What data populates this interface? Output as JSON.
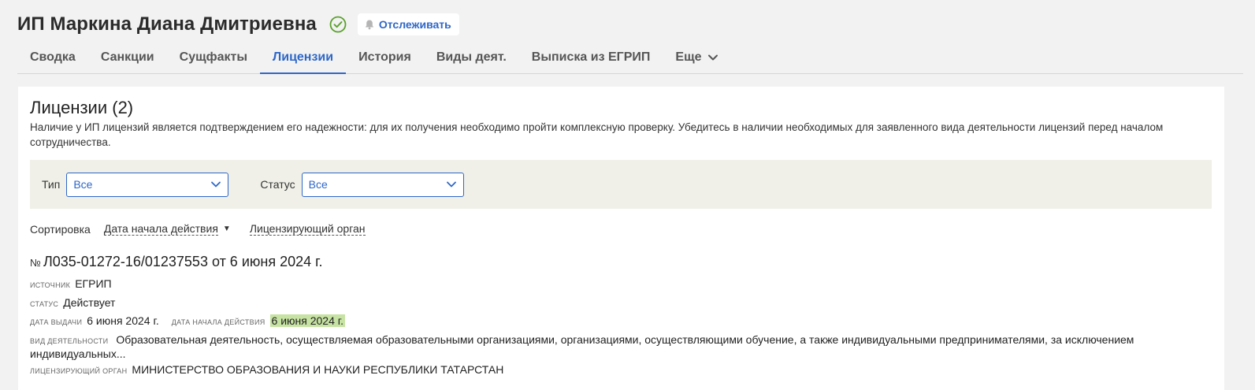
{
  "header": {
    "company_name": "ИП Маркина Диана Дмитриевна",
    "track_label": "Отслеживать"
  },
  "tabs": [
    {
      "label": "Сводка"
    },
    {
      "label": "Санкции"
    },
    {
      "label": "Сущфакты"
    },
    {
      "label": "Лицензии",
      "active": true
    },
    {
      "label": "История"
    },
    {
      "label": "Виды деят."
    },
    {
      "label": "Выписка из ЕГРИП"
    },
    {
      "label": "Еще"
    }
  ],
  "section": {
    "title": "Лицензии (2)",
    "description": "Наличие у ИП лицензий является подтверждением его надежности: для их получения необходимо пройти комплексную проверку. Убедитесь в наличии необходимых для заявленного вида деятельности лицензий перед началом сотрудничества."
  },
  "filters": {
    "type_label": "Тип",
    "type_value": "Все",
    "status_label": "Статус",
    "status_value": "Все"
  },
  "sort": {
    "label": "Сортировка",
    "option1": "Дата начала действия",
    "option2": "Лицензирующий орган"
  },
  "license": {
    "number_sign": "№",
    "title": "Л035-01272-16/01237553 от 6 июня 2024 г.",
    "source_label": "источник",
    "source": "ЕГРИП",
    "status_label": "статус",
    "status": "Действует",
    "issue_date_label": "дата выдачи",
    "issue_date": "6 июня 2024 г.",
    "start_date_label": "дата начала действия",
    "start_date": "6 июня 2024 г.",
    "activity_label": "вид деятельности",
    "activity": "Образовательная деятельность, осуществляемая образовательными организациями, организациями, осуществляющими обучение, а также индивидуальными предпринимателями, за исключением индивидуальных...",
    "authority_label": "лицензирующий орган",
    "authority": "МИНИСТЕРСТВО ОБРАЗОВАНИЯ И НАУКИ РЕСПУБЛИКИ ТАТАРСТАН"
  },
  "colors": {
    "accent": "#2e67c8",
    "success": "#5aa02c",
    "highlight": "#c7e3a3",
    "filter_bg": "#f0f0e8"
  },
  "icons": {
    "verified": "check-circle-icon",
    "track": "bell-icon",
    "dropdown": "chevron-down-icon",
    "sort": "sort-desc-icon"
  }
}
